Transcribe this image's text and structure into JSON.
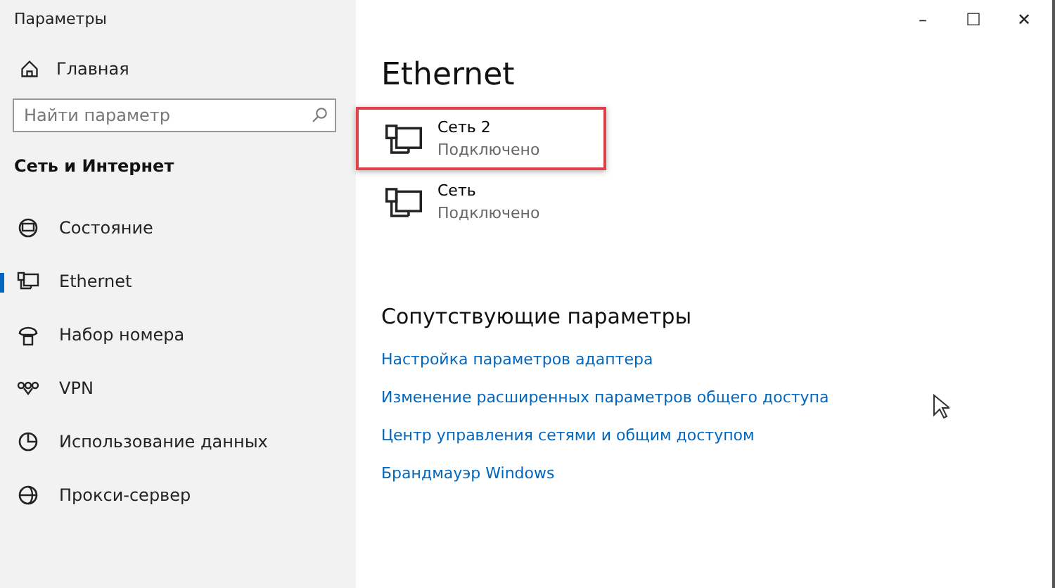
{
  "window": {
    "title": "Параметры",
    "controls": [
      "–",
      "☐",
      "✕"
    ]
  },
  "sidebar": {
    "home": "Главная",
    "search": {
      "placeholder": "Найти параметр"
    },
    "section": "Сеть и Интернет",
    "items": [
      {
        "label": "Состояние",
        "kind": "status",
        "selected": false
      },
      {
        "label": "Ethernet",
        "kind": "ethernet",
        "selected": true
      },
      {
        "label": "Набор номера",
        "kind": "dialup",
        "selected": false
      },
      {
        "label": "VPN",
        "kind": "vpn",
        "selected": false
      },
      {
        "label": "Использование данных",
        "kind": "data",
        "selected": false
      },
      {
        "label": "Прокси-сервер",
        "kind": "proxy",
        "selected": false
      }
    ]
  },
  "main": {
    "title": "Ethernet",
    "networks": [
      {
        "name": "Сеть 2",
        "status": "Подключено",
        "highlighted": true
      },
      {
        "name": "Сеть",
        "status": "Подключено",
        "highlighted": false
      }
    ],
    "related_title": "Сопутствующие параметры",
    "links": [
      "Настройка параметров адаптера",
      "Изменение расширенных параметров общего доступа",
      "Центр управления сетями и общим доступом",
      "Брандмауэр Windows"
    ]
  }
}
